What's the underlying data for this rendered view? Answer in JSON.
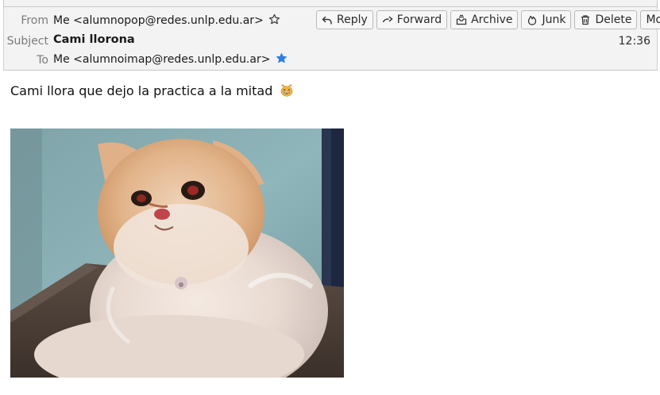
{
  "header": {
    "from_label": "From",
    "from_value": "Me <alumnopop@redes.unlp.edu.ar>",
    "subject_label": "Subject",
    "subject_value": "Cami llorona",
    "to_label": "To",
    "to_value": "Me <alumnoimap@redes.unlp.edu.ar>",
    "time": "12:36"
  },
  "toolbar": {
    "reply": "Reply",
    "forward": "Forward",
    "archive": "Archive",
    "junk": "Junk",
    "delete": "Delete",
    "more": "More"
  },
  "message": {
    "body": "Cami llora que dejo la practica a la mitad"
  },
  "icons": [
    "star-outline-icon",
    "star-filled-icon",
    "reply-icon",
    "forward-icon",
    "archive-icon",
    "junk-icon",
    "trash-icon",
    "chevron-down-icon",
    "crying-cat-emoji"
  ],
  "colors": {
    "accent_blue": "#2f7fe0",
    "header_bg": "#f3f3f3"
  }
}
